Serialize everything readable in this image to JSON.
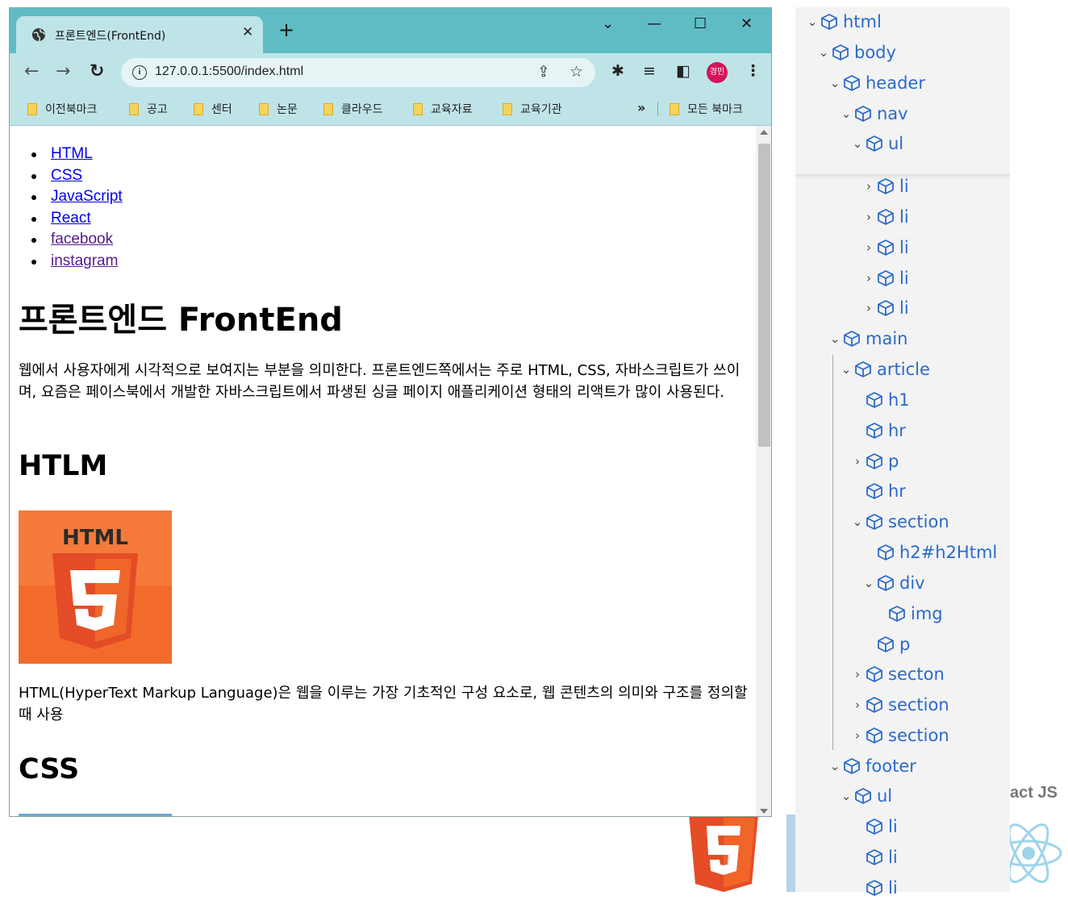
{
  "browser": {
    "tab_title": "프론트엔드(FrontEnd)",
    "tab_close": "✕",
    "new_tab": "+",
    "window_controls": [
      "⌄",
      "—",
      "☐",
      "✕"
    ],
    "url": "127.0.0.1:5500/index.html",
    "profile_initials": "경민",
    "bookmarks": [
      "이전북마크",
      "공고",
      "센터",
      "논문",
      "클라우드",
      "교육자료",
      "교육기관"
    ],
    "bookmarks_more": "»",
    "all_bookmarks": "모든 북마크"
  },
  "page": {
    "nav_links": [
      "HTML",
      "CSS",
      "JavaScript",
      "React",
      "facebook",
      "instagram"
    ],
    "h1": "프론트엔드 FrontEnd",
    "intro": "웹에서 사용자에게 시각적으로 보여지는 부분을 의미한다. 프론트엔드쪽에서는 주로 HTML, CSS, 자바스크립트가 쓰이며, 요즘은 페이스북에서 개발한 자바스크립트에서 파생된 싱글 페이지 애플리케이션 형태의 리액트가 많이 사용된다.",
    "section_title": "HTLM",
    "logo_text": "HTML",
    "logo_digit": "5",
    "html_desc": "HTML(HyperText Markup Language)은 웹을 이루는 가장 기초적인 구성 요소로, 웹 콘텐츠의 의미와 구조를 정의할 때 사용",
    "css_title": "CSS"
  },
  "tree": [
    {
      "label": "html",
      "chev": "⌄"
    },
    {
      "label": "body",
      "chev": "⌄"
    },
    {
      "label": "header",
      "chev": "⌄"
    },
    {
      "label": "nav",
      "chev": "⌄"
    },
    {
      "label": "ul",
      "chev": "⌄"
    },
    {
      "label": "li",
      "chev": "›"
    },
    {
      "label": "li",
      "chev": "›"
    },
    {
      "label": "li",
      "chev": "›"
    },
    {
      "label": "li",
      "chev": "›"
    },
    {
      "label": "li",
      "chev": "›"
    },
    {
      "label": "main",
      "chev": "⌄"
    },
    {
      "label": "article",
      "chev": "⌄"
    },
    {
      "label": "h1",
      "chev": ""
    },
    {
      "label": "hr",
      "chev": ""
    },
    {
      "label": "p",
      "chev": "›"
    },
    {
      "label": "hr",
      "chev": ""
    },
    {
      "label": "section",
      "chev": "⌄"
    },
    {
      "label": "h2#h2Html",
      "chev": ""
    },
    {
      "label": "div",
      "chev": "⌄"
    },
    {
      "label": "img",
      "chev": ""
    },
    {
      "label": "p",
      "chev": ""
    },
    {
      "label": "secton",
      "chev": "›"
    },
    {
      "label": "section",
      "chev": "›"
    },
    {
      "label": "section",
      "chev": "›"
    },
    {
      "label": "footer",
      "chev": "⌄"
    },
    {
      "label": "ul",
      "chev": "⌄"
    },
    {
      "label": "li",
      "chev": ""
    },
    {
      "label": "li",
      "chev": ""
    },
    {
      "label": "li",
      "chev": ""
    }
  ],
  "background": {
    "react_label": "act JS",
    "html5_digit": "5"
  },
  "colors": {
    "titlebar": "#5fbcc5",
    "toolbar": "#bfe4e8",
    "link": "#0000ee",
    "visited": "#551a8b",
    "tree_label": "#2b6ac9",
    "html5_orange": "#f16529"
  }
}
